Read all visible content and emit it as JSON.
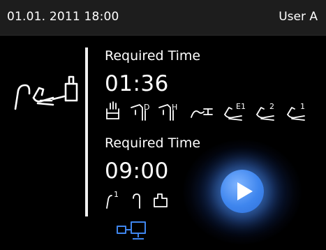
{
  "status_bar": {
    "datetime": "01.01. 2011 18:00",
    "user": "User A"
  },
  "device": {
    "icon": "handpiece-device-icon"
  },
  "section_1": {
    "label": "Required Time",
    "time": "01:36",
    "program_icons": [
      "hand-wash-icon",
      "pipe-d-icon",
      "pipe-h-icon",
      "tube-icon",
      "handpiece-e1-icon",
      "handpiece-2-icon",
      "handpiece-1-icon"
    ],
    "program_labels": [
      "D",
      "H",
      "E1",
      "2",
      "1"
    ]
  },
  "section_2": {
    "label": "Required Time",
    "time": "09:00",
    "program_icons": [
      "hook-1-icon",
      "hook-icon",
      "container-icon"
    ],
    "program_labels": [
      "1"
    ]
  },
  "controls": {
    "play_icon": "play-icon",
    "network_icon": "network-connection-icon"
  },
  "colors": {
    "background": "#000000",
    "status_bar": "#1d1d1d",
    "text": "#ffffff",
    "accent_blue": "#3f86ee"
  }
}
